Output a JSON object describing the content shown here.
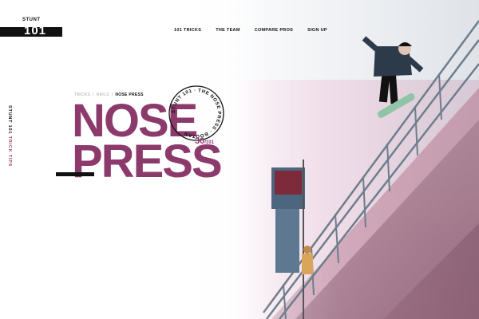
{
  "brand": {
    "small_label": "STUNT",
    "number": "101"
  },
  "nav": {
    "items": [
      {
        "label": "101 TRICKS"
      },
      {
        "label": "THE TEAM"
      },
      {
        "label": "COMPARE PROS"
      },
      {
        "label": "SIGN UP"
      }
    ]
  },
  "side": {
    "brand": "STUNT 101",
    "tag": "TRICK TIPS"
  },
  "breadcrumb": {
    "items": [
      "TRICKS",
      "RAILS"
    ],
    "current": "NOSE PRESS"
  },
  "headline": {
    "line1": "NOSE",
    "line2": "PRESS"
  },
  "stamp": {
    "ring_text": "STUNT 101 · THE NOSE PRESS · BOOTAN",
    "count": "30",
    "count_suffix": "/101"
  },
  "colors": {
    "accent": "#8c3a6c",
    "text": "#111111",
    "muted": "#aaaaaa"
  }
}
